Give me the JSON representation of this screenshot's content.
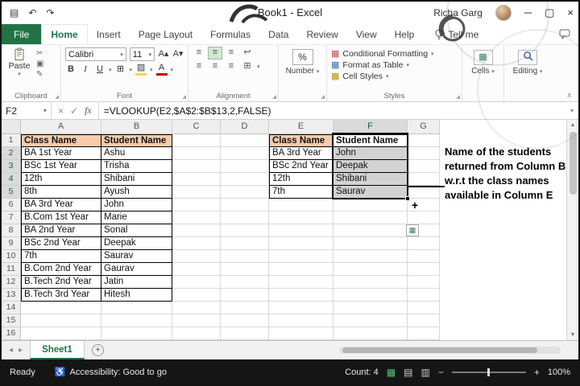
{
  "titlebar": {
    "title": "Book1 - Excel",
    "user": "Richa Garg"
  },
  "ribbon": {
    "tabs": [
      "File",
      "Home",
      "Insert",
      "Page Layout",
      "Formulas",
      "Data",
      "Review",
      "View",
      "Help"
    ],
    "active_tab": "Home",
    "tell_me": "Tell me",
    "groups": {
      "clipboard": {
        "label": "Clipboard",
        "paste": "Paste"
      },
      "font": {
        "label": "Font",
        "font_name": "Calibri",
        "font_size": "11"
      },
      "alignment": {
        "label": "Alignment"
      },
      "number": {
        "label": "Number"
      },
      "styles": {
        "label": "Styles",
        "conditional_formatting": "Conditional Formatting",
        "format_as_table": "Format as Table",
        "cell_styles": "Cell Styles"
      },
      "cells": {
        "label": "Cells"
      },
      "editing": {
        "label": "Editing"
      }
    }
  },
  "formula_bar": {
    "name_box": "F2",
    "formula": "=VLOOKUP(E2,$A$2:$B$13,2,FALSE)"
  },
  "sheet": {
    "col_headers": [
      "A",
      "B",
      "C",
      "D",
      "E",
      "F",
      "G"
    ],
    "row_count": 16,
    "left_table": {
      "origin": "A1",
      "headers": [
        "Class Name",
        "Student Name"
      ],
      "rows": [
        [
          "BA 1st Year",
          "Ashu"
        ],
        [
          "BSc 1st Year",
          "Trisha"
        ],
        [
          "12th",
          "Shibani"
        ],
        [
          "8th",
          "Ayush"
        ],
        [
          "BA 3rd Year",
          "John"
        ],
        [
          "B.Com 1st Year",
          "Marie"
        ],
        [
          "BA 2nd Year",
          "Sonal"
        ],
        [
          "BSc 2nd Year",
          "Deepak"
        ],
        [
          "7th",
          "Saurav"
        ],
        [
          "B.Com 2nd Year",
          "Gaurav"
        ],
        [
          "B.Tech 2nd Year",
          "Jatin"
        ],
        [
          "B.Tech 3rd Year",
          "Hitesh"
        ]
      ]
    },
    "lookup_table": {
      "origin": "E1",
      "headers": [
        "Class Name",
        "Student Name"
      ],
      "rows": [
        [
          "BA 3rd Year",
          "John"
        ],
        [
          "BSc 2nd Year",
          "Deepak"
        ],
        [
          "12th",
          "Shibani"
        ],
        [
          "7th",
          "Saurav"
        ]
      ]
    },
    "selection": {
      "range": "F1:F5",
      "active_cell": "F2"
    }
  },
  "annotation": {
    "text": "Name of the students returned from Column B w.r.t the class names available in Column E"
  },
  "sheet_tabs": {
    "active": "Sheet1"
  },
  "status_bar": {
    "mode": "Ready",
    "accessibility": "Accessibility: Good to go",
    "count": "Count: 4",
    "zoom": "100%"
  },
  "colors": {
    "excel_green": "#217346",
    "table_header_fill": "#F8CBAD",
    "selection_fill": "#D2D2D2"
  },
  "icons": {
    "save": "▤",
    "undo": "↶",
    "redo": "↷",
    "minimize": "─",
    "maximize": "▢",
    "close": "×",
    "dropdown": "▾",
    "launcher": "◢",
    "collapse": "∧",
    "cut": "✂",
    "copy": "▣",
    "format_painter": "✎",
    "bold": "B",
    "italic": "I",
    "underline": "U",
    "increase_font": "A▴",
    "decrease_font": "A▾",
    "borders": "⊞",
    "fill_color": "▨",
    "font_color": "A",
    "align": "≡",
    "wrap_text": "↩",
    "merge_center": "⊞",
    "percent": "%",
    "styles_grid": "▦",
    "cells": "▦",
    "cancel": "×",
    "check": "✓",
    "fx": "fx",
    "up": "▲",
    "down": "▼",
    "left": "◂",
    "right": "▸",
    "new_sheet": "+",
    "plus": "+",
    "fill_options": "▦",
    "accessibility": "♿",
    "view_normal": "▦",
    "view_layout": "▤",
    "view_break": "▥",
    "zoom_out": "−",
    "zoom_in": "+"
  }
}
